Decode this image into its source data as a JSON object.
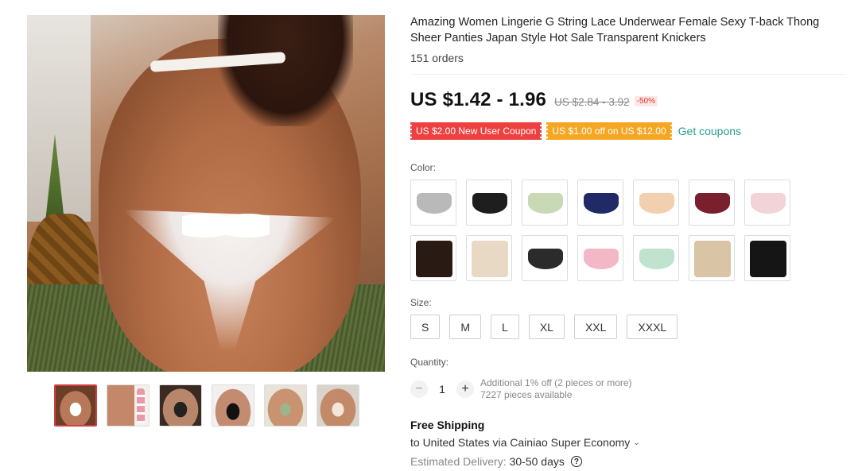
{
  "product": {
    "title": "Amazing Women Lingerie G String Lace Underwear Female Sexy T-back Thong Sheer Panties Japan Style Hot Sale Transparent Knickers",
    "orders": "151 orders"
  },
  "price": {
    "current": "US $1.42 - 1.96",
    "original": "US $2.84 - 3.92",
    "discount": "-50%"
  },
  "coupons": {
    "new_user": "US $2.00 New User Coupon",
    "spend_off": "US $1.00 off on US $12.00",
    "get_link": "Get coupons",
    "colors": {
      "new_user_bg": "#ee4040",
      "spend_off_bg": "#f5a623",
      "link": "#2a9d8f"
    }
  },
  "color": {
    "label": "Color:",
    "options": [
      {
        "name": "grey-lace",
        "color": "#b9b9b9"
      },
      {
        "name": "black-lace",
        "color": "#1e1e1e"
      },
      {
        "name": "green-lace",
        "color": "#c9d9b6"
      },
      {
        "name": "navy-lace",
        "color": "#1f2a66"
      },
      {
        "name": "nude-lace",
        "color": "#f2cfae"
      },
      {
        "name": "wine-lace",
        "color": "#7a1f2e"
      },
      {
        "name": "pink-lace",
        "color": "#f1d3d8"
      },
      {
        "name": "black-model",
        "color": "#2a1a14"
      },
      {
        "name": "beige-model",
        "color": "#e7d9c3"
      },
      {
        "name": "black-pink-thong",
        "color": "#2b2b2b"
      },
      {
        "name": "pink-thong",
        "color": "#f3b7c6"
      },
      {
        "name": "mint-thong",
        "color": "#bfe3cf"
      },
      {
        "name": "beige-back",
        "color": "#d9c4a5"
      },
      {
        "name": "black-back",
        "color": "#151515"
      }
    ]
  },
  "size": {
    "label": "Size:",
    "options": [
      "S",
      "M",
      "L",
      "XL",
      "XXL",
      "XXXL"
    ]
  },
  "quantity": {
    "label": "Quantity:",
    "value": "1",
    "minus": "−",
    "plus": "+",
    "note_discount": "Additional 1% off (2 pieces or more)",
    "note_available": "7227 pieces available"
  },
  "shipping": {
    "title": "Free Shipping",
    "destination": "to United States via Cainiao Super Economy",
    "chevron": "⌄",
    "delivery_label": "Estimated Delivery:",
    "delivery_days": "30-50 days",
    "help": "?"
  }
}
